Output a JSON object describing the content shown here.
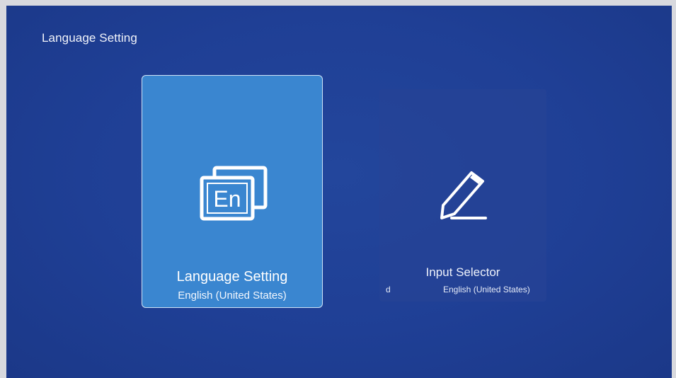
{
  "header": {
    "title": "Language Setting"
  },
  "tiles": [
    {
      "icon": "language-en-icon",
      "icon_text": "En",
      "title": "Language Setting",
      "value": "English (United States)",
      "selected": true
    },
    {
      "icon": "pencil-icon",
      "title": "Input Selector",
      "value_fragment_left": "d",
      "value": "English (United States)",
      "selected": false
    }
  ],
  "colors": {
    "background": "#1f3f95",
    "selected_tile": "#3a86d0",
    "text": "#ffffff"
  }
}
